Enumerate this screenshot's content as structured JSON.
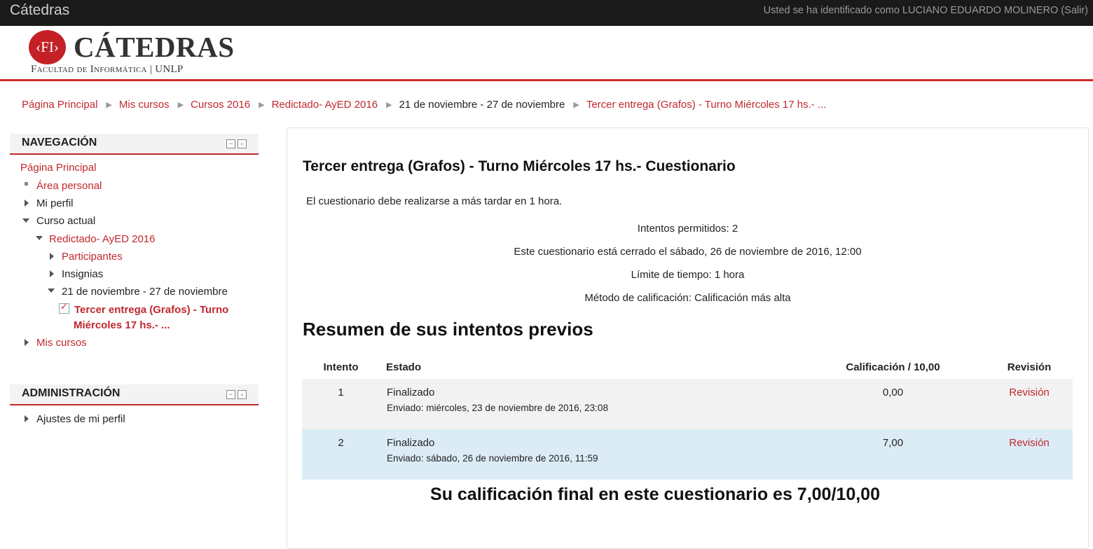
{
  "topbar": {
    "brand": "Cátedras",
    "login_text": "Usted se ha identificado como LUCIANO EDUARDO MOLINERO (Salir)"
  },
  "logo": {
    "mark": "‹FI›",
    "title": "CÁTEDRAS",
    "subtitle": "Facultad de Informática | UNLP"
  },
  "breadcrumb": [
    "Página Principal",
    "Mis cursos",
    "Cursos 2016",
    "Redictado- AyED 2016",
    "21 de noviembre - 27 de noviembre",
    "Tercer entrega (Grafos) - Turno Miércoles 17 hs.- ..."
  ],
  "navigation": {
    "title": "NAVEGACIÓN",
    "items": {
      "home": "Página Principal",
      "personal_area": "Área personal",
      "profile": "Mi perfil",
      "current_course": "Curso actual",
      "course": "Redictado- AyED 2016",
      "participants": "Participantes",
      "badges": "Insignias",
      "week": "21 de noviembre - 27 de noviembre",
      "quiz_line1": "Tercer entrega (Grafos) - Turno",
      "quiz_line2": "Miércoles 17 hs.- ...",
      "my_courses": "Mis cursos"
    }
  },
  "administration": {
    "title": "ADMINISTRACIÓN",
    "items": {
      "profile_settings": "Ajustes de mi perfil"
    }
  },
  "main": {
    "title": "Tercer entrega (Grafos) - Turno Miércoles 17 hs.- Cuestionario",
    "intro": "El cuestionario debe realizarse a más tardar en 1 hora.",
    "info": {
      "attempts": "Intentos permitidos: 2",
      "closed": "Este cuestionario está cerrado el sábado, 26 de noviembre de 2016, 12:00",
      "time_limit": "Límite de tiempo: 1 hora",
      "grading": "Método de calificación: Calificación más alta"
    },
    "summary_title": "Resumen de sus intentos previos",
    "table": {
      "headers": {
        "attempt": "Intento",
        "state": "Estado",
        "grade": "Calificación / 10,00",
        "review": "Revisión"
      },
      "rows": [
        {
          "attempt": "1",
          "state": "Finalizado",
          "submitted": "Enviado: miércoles, 23 de noviembre de 2016, 23:08",
          "grade": "0,00",
          "review": "Revisión"
        },
        {
          "attempt": "2",
          "state": "Finalizado",
          "submitted": "Enviado: sábado, 26 de noviembre de 2016, 11:59",
          "grade": "7,00",
          "review": "Revisión"
        }
      ]
    },
    "final_grade": "Su calificación final en este cuestionario es 7,00/10,00"
  },
  "colors": {
    "accent": "#c0282d",
    "topbar": "#1a1a1a",
    "row_highlight": "#dcecf6",
    "row_alt": "#f2f2f2"
  }
}
